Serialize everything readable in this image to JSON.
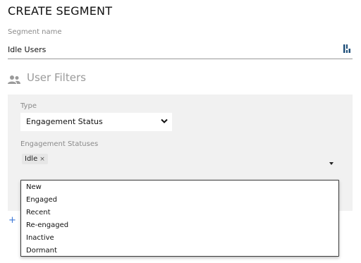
{
  "page": {
    "title": "CREATE SEGMENT"
  },
  "segment": {
    "label": "Segment name",
    "value": "Idle Users",
    "icon": "text-format-icon"
  },
  "user_filters": {
    "title": "User Filters",
    "icon": "group-icon"
  },
  "type": {
    "label": "Type",
    "value": "Engagement Status",
    "icon": "chevron-down-icon"
  },
  "engagement_statuses": {
    "label": "Engagement Statuses",
    "selected": [
      {
        "label": "Idle",
        "remove": "×"
      }
    ],
    "options": [
      {
        "label": "New"
      },
      {
        "label": "Engaged"
      },
      {
        "label": "Recent"
      },
      {
        "label": "Re-engaged"
      },
      {
        "label": "Inactive"
      },
      {
        "label": "Dormant"
      }
    ]
  },
  "add_filter": {
    "icon_text": "+"
  },
  "colors": {
    "accent": "#3a76d6",
    "panel": "#f1f1f1"
  }
}
